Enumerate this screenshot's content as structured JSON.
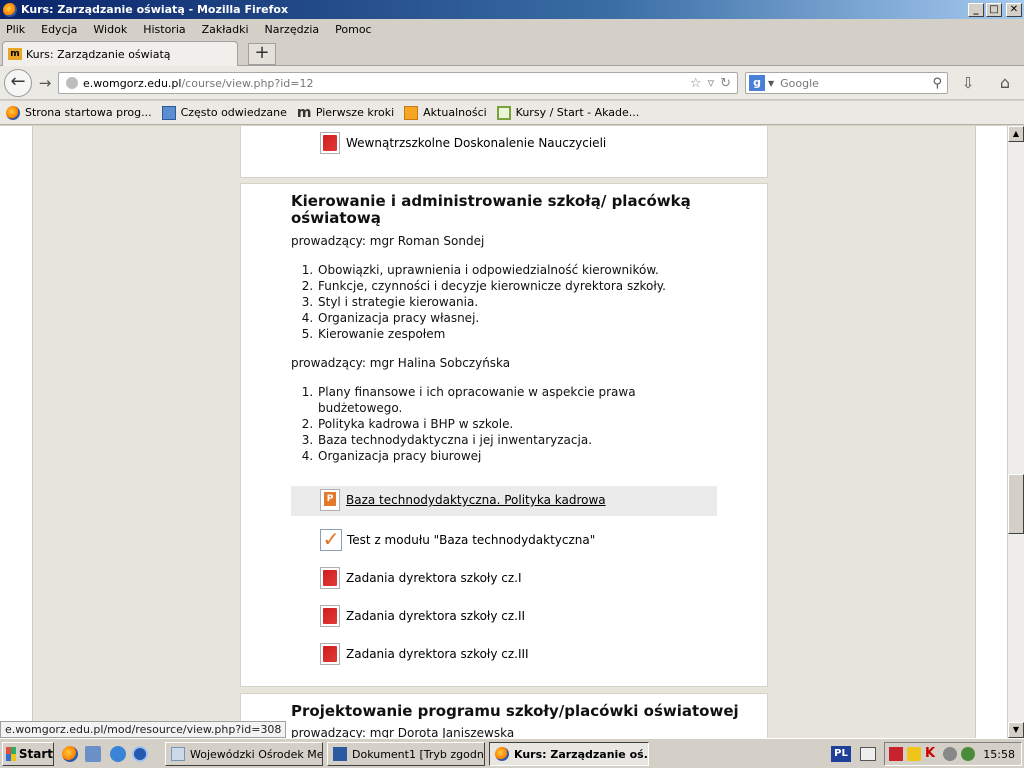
{
  "window": {
    "title": "Kurs: Zarządzanie oświatą - Mozilla Firefox",
    "controls": [
      "_",
      "□",
      "✕"
    ]
  },
  "menu": [
    "Plik",
    "Edycja",
    "Widok",
    "Historia",
    "Zakładki",
    "Narzędzia",
    "Pomoc"
  ],
  "tab": {
    "title": "Kurs: Zarządzanie oświatą",
    "favicon_text": "m"
  },
  "address": {
    "host": "e.womgorz.edu.pl",
    "path": "/course/view.php?id=12"
  },
  "search": {
    "engine": "g",
    "placeholder": "Google"
  },
  "bookmarks": [
    {
      "label": "Strona startowa prog...",
      "icon": "firefox-icon"
    },
    {
      "label": "Często odwiedzane",
      "icon": "folder-icon"
    },
    {
      "label": "Pierwsze kroki",
      "icon": "m-icon"
    },
    {
      "label": "Aktualności",
      "icon": "rss-icon"
    },
    {
      "label": "Kursy / Start - Akade...",
      "icon": "course-icon"
    }
  ],
  "top_section": {
    "resource": "Wewnątrzszkolne Doskonalenie Nauczycieli"
  },
  "main_section": {
    "title_line1": "Kierowanie i administrowanie szkołą/ placówką",
    "title_line2": "oświatową",
    "teacher1": "prowadzący: mgr Roman Sondej",
    "list1": [
      "Obowiązki, uprawnienia i odpowiedzialność kierowników.",
      " Funkcje, czynności i decyzje kierownicze dyrektora szkoły.",
      "Styl i strategie kierowania.",
      "Organizacja pracy własnej.",
      "Kierowanie zespołem"
    ],
    "teacher2": "prowadzący: mgr Halina Sobczyńska",
    "list2": [
      "Plany finansowe i ich opracowanie w aspekcie prawa budżetowego.",
      "Polityka kadrowa i BHP w szkole.",
      "Baza technodydaktyczna i jej inwentaryzacja.",
      "Organizacja pracy biurowej"
    ],
    "resources": [
      "Baza technodydaktyczna. Polityka kadrowa",
      "Test z modułu \"Baza technodydaktyczna\"",
      "Zadania dyrektora szkoły cz.I",
      "Zadania dyrektora szkoły cz.II",
      "Zadania dyrektora szkoły cz.III"
    ]
  },
  "next_section": {
    "title": "Projektowanie programu szkoły/placówki oświatowej",
    "teacher": "prowadzący: mgr Dorota Janiszewska"
  },
  "status_link": "e.womgorz.edu.pl/mod/resource/view.php?id=308",
  "taskbar": {
    "start": "Start",
    "tasks": [
      "Wojewódzki Ośrodek Me...",
      "Dokument1 [Tryb zgodn...",
      "Kurs: Zarządzanie oś..."
    ],
    "language": "PL",
    "clock": "15:58"
  }
}
